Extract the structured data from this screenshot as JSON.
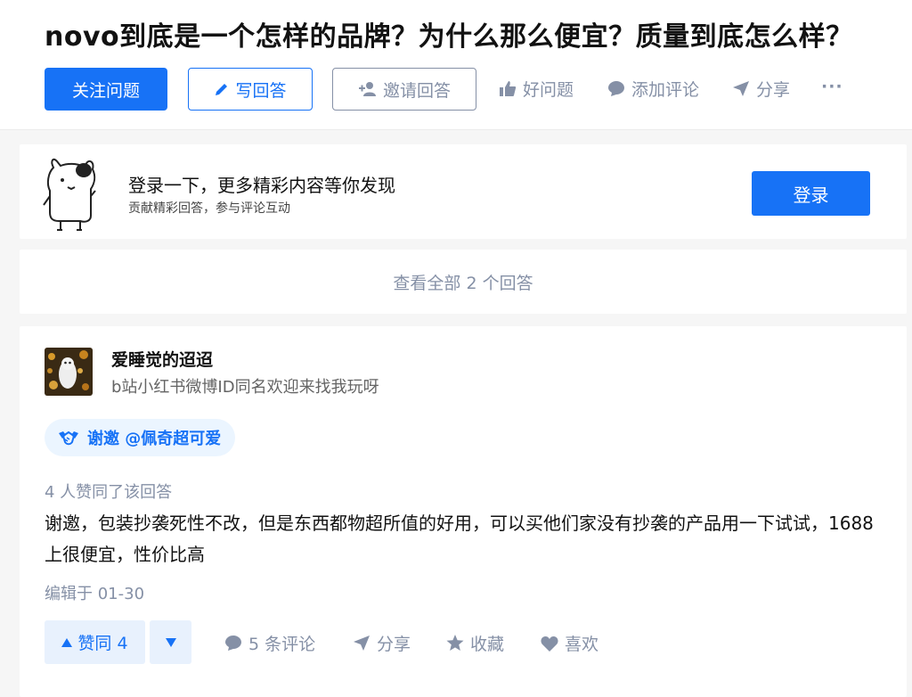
{
  "question": {
    "title": "novo到底是一个怎样的品牌？为什么那么便宜？质量到底怎么样？"
  },
  "actions": {
    "follow": "关注问题",
    "write": "写回答",
    "invite": "邀请回答",
    "good_question": "好问题",
    "add_comment": "添加评论",
    "share": "分享",
    "more": "···"
  },
  "login_prompt": {
    "title": "登录一下，更多精彩内容等你发现",
    "subtitle": "贡献精彩回答，参与评论互动",
    "button": "登录"
  },
  "view_all": "查看全部 2 个回答",
  "answer": {
    "author_name": "爱睡觉的迢迢",
    "author_bio": "b站小红书微博ID同名欢迎来找我玩呀",
    "thanks_tag": "谢邀 @佩奇超可爱",
    "vote_summary": "4 人赞同了该回答",
    "content": "谢邀，包装抄袭死性不改，但是东西都物超所值的好用，可以买他们家没有抄袭的产品用一下试试，1688上很便宜，性价比高",
    "edited": "编辑于 01-30",
    "vote_up_label": "赞同 4",
    "comments": "5 条评论",
    "share": "分享",
    "collect": "收藏",
    "like": "喜欢"
  },
  "colors": {
    "brand_blue": "#1772f6",
    "muted_gray": "#8590a6",
    "tag_bg": "#ebf5ff",
    "page_bg": "#f6f6f6"
  }
}
